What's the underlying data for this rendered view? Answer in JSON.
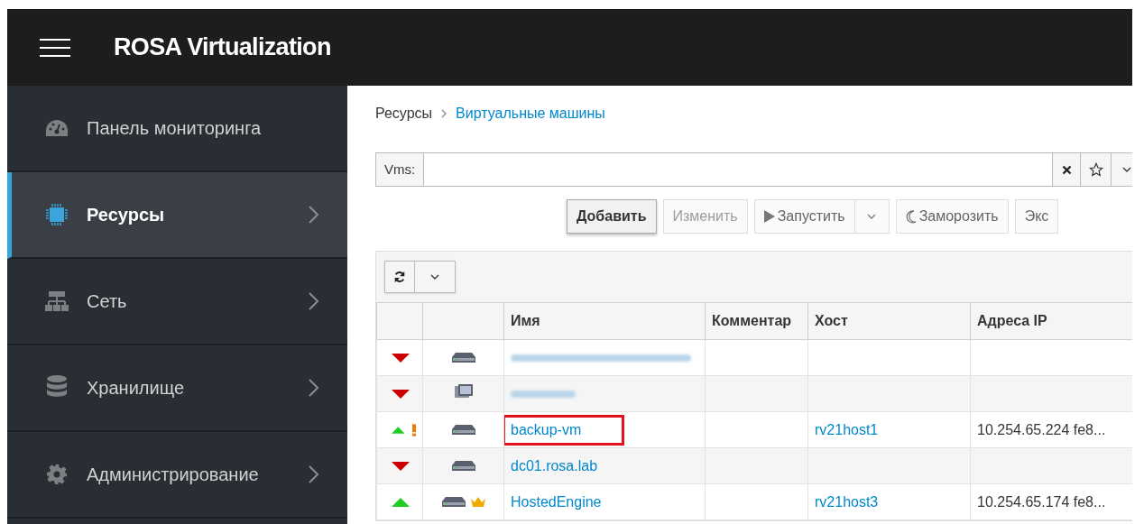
{
  "header": {
    "title": "ROSA Virtualization"
  },
  "sidebar": {
    "items": [
      {
        "label": "Панель мониторинга",
        "selected": false,
        "has_children": false
      },
      {
        "label": "Ресурсы",
        "selected": true,
        "has_children": true
      },
      {
        "label": "Сеть",
        "selected": false,
        "has_children": true
      },
      {
        "label": "Хранилище",
        "selected": false,
        "has_children": true
      },
      {
        "label": "Администрирование",
        "selected": false,
        "has_children": true
      }
    ]
  },
  "breadcrumb": [
    "Ресурсы",
    "Виртуальные машины"
  ],
  "search": {
    "label": "Vms:"
  },
  "toolbar": [
    {
      "label": "Добавить",
      "kind": "primary",
      "disabled": false
    },
    {
      "label": "Изменить",
      "kind": "plain",
      "disabled": true
    },
    {
      "label": "Запустить",
      "kind": "play",
      "disabled": false
    },
    {
      "label": "Заморозить",
      "kind": "moon",
      "disabled": false
    },
    {
      "label": "Экс",
      "kind": "plain",
      "disabled": false
    }
  ],
  "table": {
    "columns": [
      "",
      "",
      "Имя",
      "Комментар",
      "Хост",
      "Адреса IP"
    ],
    "rows": [
      {
        "running": false,
        "kind": "server",
        "warning": false,
        "hosted_engine": false,
        "redacted": true,
        "highlighted": false
      },
      {
        "running": false,
        "kind": "desktop",
        "warning": false,
        "hosted_engine": false,
        "redacted": true,
        "highlighted": false
      },
      {
        "running": true,
        "kind": "server",
        "warning": true,
        "hosted_engine": false,
        "redacted": false,
        "highlighted": true,
        "name": "backup-vm",
        "host": "rv21host1",
        "ip": "10.254.65.224 fe8..."
      },
      {
        "running": false,
        "kind": "server",
        "warning": false,
        "hosted_engine": false,
        "redacted": false,
        "highlighted": false,
        "name": "dc01.rosa.lab"
      },
      {
        "running": true,
        "kind": "server",
        "warning": false,
        "hosted_engine": true,
        "redacted": false,
        "highlighted": false,
        "name": "HostedEngine",
        "host": "rv21host3",
        "ip": "10.254.65.174 fe8..."
      }
    ]
  }
}
